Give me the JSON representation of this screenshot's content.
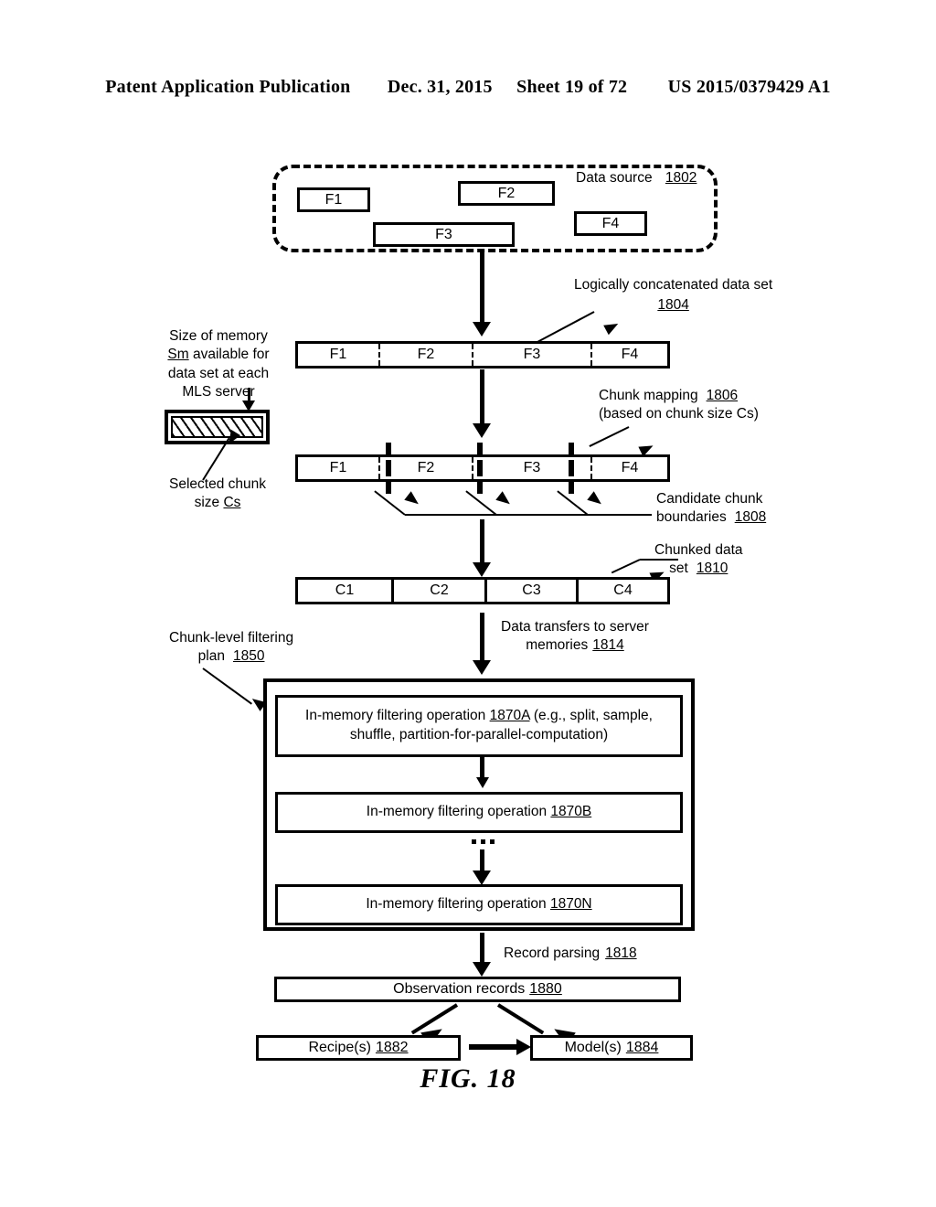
{
  "header": {
    "publication": "Patent Application Publication",
    "date": "Dec. 31, 2015",
    "sheet": "Sheet 19 of 72",
    "patent_number": "US 2015/0379429 A1"
  },
  "figure": {
    "caption": "FIG. 18"
  },
  "data_source": {
    "label": "Data source",
    "ref": "1802",
    "files": [
      {
        "label": "F1"
      },
      {
        "label": "F2"
      },
      {
        "label": "F3"
      },
      {
        "label": "F4"
      }
    ]
  },
  "concatenated": {
    "label_line1": "Logically concatenated data set",
    "ref": "1804",
    "segments": [
      {
        "label": "F1"
      },
      {
        "label": "F2"
      },
      {
        "label": "F3"
      },
      {
        "label": "F4"
      }
    ]
  },
  "memory": {
    "caption_line1": "Size of memory",
    "caption_line2_a": "Sm",
    "caption_line2_b": " available for",
    "caption_line3": "data set at each",
    "caption_line4": "MLS server",
    "chunk_caption_line1": "Selected chunk",
    "chunk_caption_line2_a": "size ",
    "chunk_caption_line2_b": "Cs"
  },
  "chunk_mapping": {
    "label_line1": "Chunk mapping",
    "ref": "1806",
    "label_line2": "(based on chunk size Cs)",
    "segments": [
      {
        "label": "F1"
      },
      {
        "label": "F2"
      },
      {
        "label": "F3"
      },
      {
        "label": "F4"
      }
    ],
    "boundaries_label_line1": "Candidate chunk",
    "boundaries_label_line2": "boundaries",
    "boundaries_ref": "1808"
  },
  "chunked_set": {
    "label_line1": "Chunked data",
    "label_line2": "set",
    "ref": "1810",
    "chunks": [
      {
        "label": "C1"
      },
      {
        "label": "C2"
      },
      {
        "label": "C3"
      },
      {
        "label": "C4"
      }
    ]
  },
  "transfers": {
    "label_line1": "Data transfers to server",
    "label_line2": "memories",
    "ref": "1814"
  },
  "filter_plan": {
    "label_line1": "Chunk-level filtering",
    "label_line2": "plan",
    "ref": "1850",
    "operations": [
      {
        "prefix": "In-memory filtering operation ",
        "ref": "1870A",
        "suffix": " (e.g., split, sample, shuffle, partition-for-parallel-computation)"
      },
      {
        "prefix": "In-memory filtering operation ",
        "ref": "1870B",
        "suffix": ""
      },
      {
        "prefix": "In-memory filtering operation ",
        "ref": "1870N",
        "suffix": ""
      }
    ]
  },
  "record_parsing": {
    "label": "Record parsing",
    "ref": "1818"
  },
  "observation_records": {
    "label": "Observation records",
    "ref": "1880"
  },
  "recipes": {
    "label": "Recipe(s)",
    "ref": "1882"
  },
  "models": {
    "label": "Model(s)",
    "ref": "1884"
  }
}
